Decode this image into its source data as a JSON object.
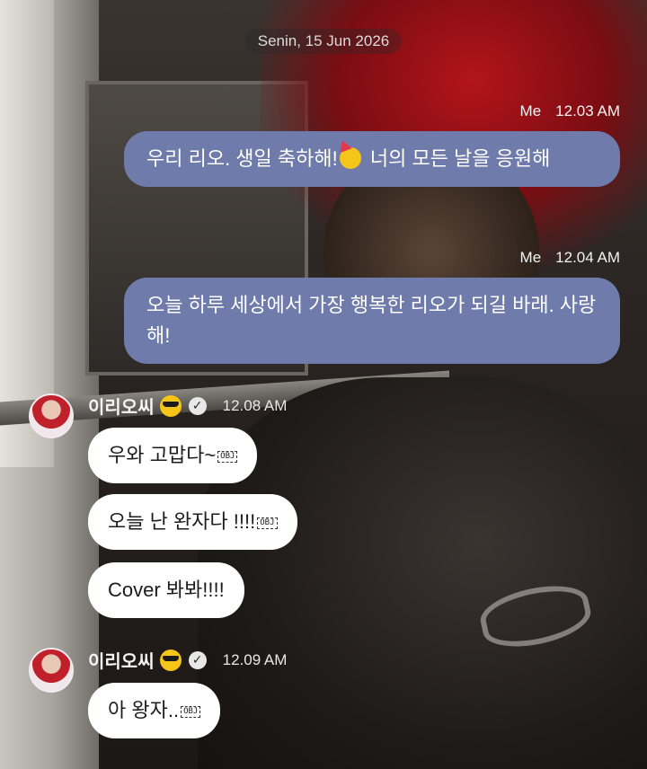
{
  "date_separator": "Senin, 15 Jun 2026",
  "outgoing": [
    {
      "sender": "Me",
      "time": "12.03 AM",
      "text_before": "우리 리오. 생일 축하해!",
      "emoji": "partying-face-icon",
      "text_after": " 너의 모든 날을 응원해"
    },
    {
      "sender": "Me",
      "time": "12.04 AM",
      "text": "오늘 하루 세상에서 가장 행복한 리오가 되길 바래. 사랑해!"
    }
  ],
  "incoming_groups": [
    {
      "sender": "이리오씨",
      "time": "12.08 AM",
      "messages": [
        {
          "text": "우와 고맙다~",
          "obj": "OBJ"
        },
        {
          "text": "오늘 난 완자다 !!!!",
          "obj": "OBJ"
        },
        {
          "text": "Cover 봐봐!!!!",
          "obj": ""
        }
      ]
    },
    {
      "sender": "이리오씨",
      "time": "12.09 AM",
      "messages": [
        {
          "text": "아 왕자..",
          "obj": "OBJ"
        }
      ]
    }
  ],
  "colors": {
    "outgoing_bubble": "#6f7bab",
    "incoming_bubble": "#ffffff"
  }
}
